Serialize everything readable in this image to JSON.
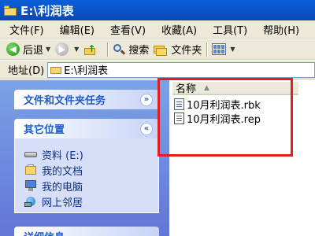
{
  "window": {
    "title": "E:\\利润表"
  },
  "menu": [
    "文件(F)",
    "编辑(E)",
    "查看(V)",
    "收藏(A)",
    "工具(T)",
    "帮助(H)"
  ],
  "toolbar": {
    "back_label": "后退",
    "search_label": "搜索",
    "folders_label": "文件夹"
  },
  "address": {
    "label": "地址(D)",
    "value": "E:\\利润表"
  },
  "left_pane": {
    "tasks_title": "文件和文件夹任务",
    "places_title": "其它位置",
    "places": [
      "资料 (E:)",
      "我的文档",
      "我的电脑",
      "网上邻居"
    ],
    "details_title": "详细信息"
  },
  "file_list": {
    "column_name": "名称",
    "files": [
      "10月利润表.rbk",
      "10月利润表.rep"
    ]
  },
  "annotation": {
    "highlight_color": "#e02020"
  }
}
